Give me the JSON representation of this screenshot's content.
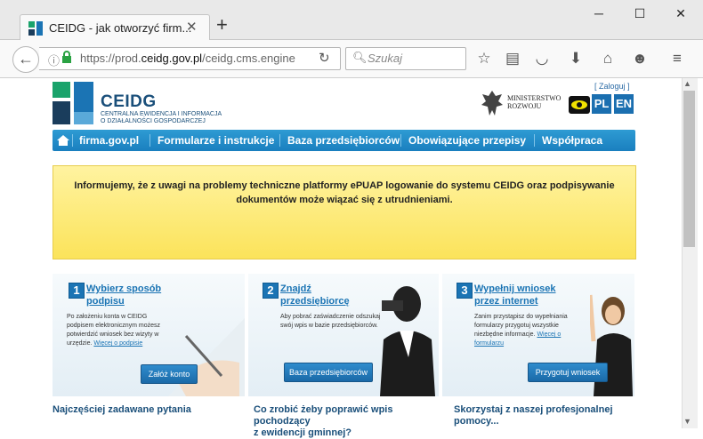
{
  "browser": {
    "tab_title": "CEIDG - jak otworzyć firm...",
    "url_prefix": "https://prod.",
    "url_domain": "ceidg.gov.pl",
    "url_path": "/ceidg.cms.engine",
    "search_placeholder": "Szukaj"
  },
  "header": {
    "logo_name": "CEIDG",
    "logo_line1": "CENTRALNA EWIDENCJA I INFORMACJA",
    "logo_line2": "O DZIAŁALNOŚCI GOSPODARCZEJ",
    "ministry_line1": "MINISTERSTWO",
    "ministry_line2": "ROZWOJU",
    "login": "[ Zaloguj ]",
    "lang_pl": "PL",
    "lang_en": "EN"
  },
  "nav": {
    "items": [
      "firma.gov.pl",
      "Formularze i instrukcje",
      "Baza przedsiębiorców",
      "Obowiązujące przepisy",
      "Współpraca"
    ]
  },
  "notice": {
    "text": "Informujemy, że z uwagi na problemy techniczne platformy ePUAP logowanie do systemu CEIDG oraz podpisywanie dokumentów może wiązać się z utrudnieniami."
  },
  "steps": [
    {
      "num": "1",
      "title_a": "Wybierz sposób",
      "title_b": "podpisu",
      "desc": "Po założeniu konta w CEIDG podpisem elektronicznym możesz potwierdzić wniosek bez wizyty w urzędzie.",
      "link": "Więcej o podpisie",
      "button": "Załóż konto"
    },
    {
      "num": "2",
      "title_a": "Znajdź",
      "title_b": "przedsiębiorcę",
      "desc": "Aby pobrać zaświadczenie odszukaj swój wpis w bazie przedsiębiorców.",
      "link": "",
      "button": "Baza przedsiębiorców"
    },
    {
      "num": "3",
      "title_a": "Wypełnij wniosek",
      "title_b": "przez internet",
      "desc": "Zanim przystąpisz do wypełniania formularzy przygotuj wszystkie niezbędne informacje.",
      "link": "Więcej o formularzu",
      "button": "Przygotuj wniosek"
    }
  ],
  "faq": [
    {
      "a": "Najczęściej zadawane pytania",
      "b": ""
    },
    {
      "a": "Co zrobić żeby poprawić wpis pochodzący",
      "b": "z ewidencji gminnej?"
    },
    {
      "a": "Skorzystaj z naszej profesjonalnej",
      "b": "pomocy..."
    }
  ]
}
